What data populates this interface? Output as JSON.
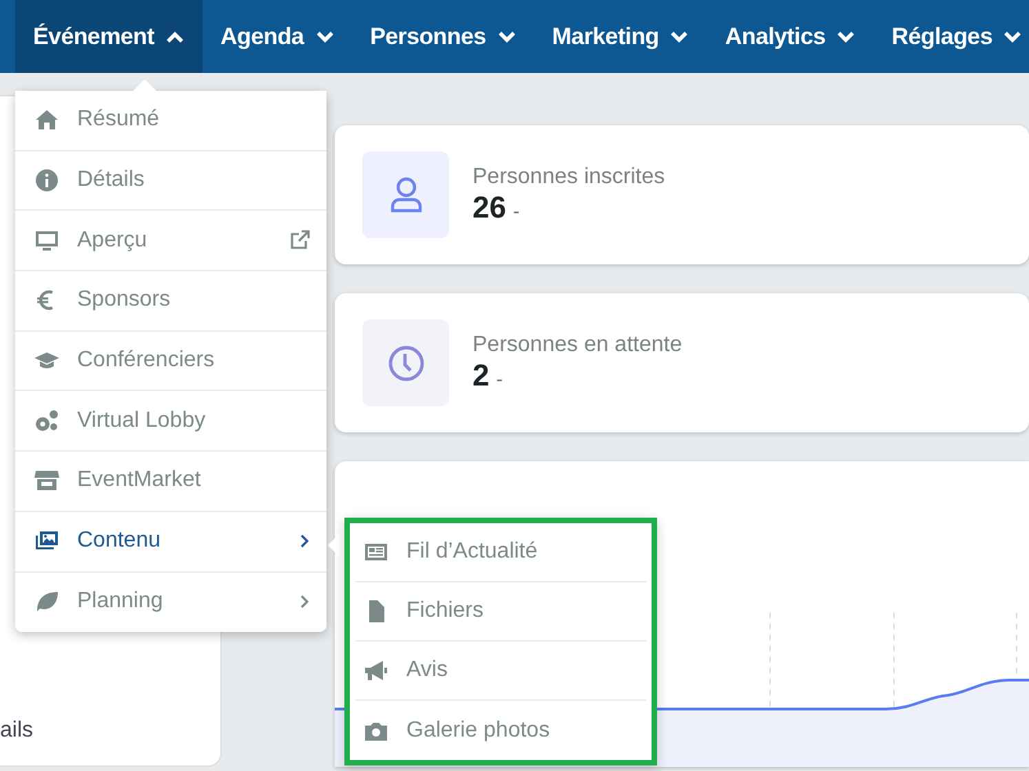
{
  "nav": {
    "items": [
      {
        "label": "Événement",
        "expanded": true,
        "selected": true
      },
      {
        "label": "Agenda",
        "expanded": false,
        "selected": false
      },
      {
        "label": "Personnes",
        "expanded": false,
        "selected": false
      },
      {
        "label": "Marketing",
        "expanded": false,
        "selected": false
      },
      {
        "label": "Analytics",
        "expanded": false,
        "selected": false
      },
      {
        "label": "Réglages",
        "expanded": false,
        "selected": false
      }
    ]
  },
  "side_panel": {
    "text": "ails"
  },
  "stats": [
    {
      "label": "Personnes inscrites",
      "value": "26",
      "suffix": "-"
    },
    {
      "label": "Personnes en attente",
      "value": "2",
      "suffix": "-"
    }
  ],
  "event_menu": {
    "items": [
      {
        "label": "Résumé",
        "selected": false,
        "external": false,
        "submenu": false
      },
      {
        "label": "Détails",
        "selected": false,
        "external": false,
        "submenu": false
      },
      {
        "label": "Aperçu",
        "selected": false,
        "external": true,
        "submenu": false
      },
      {
        "label": "Sponsors",
        "selected": false,
        "external": false,
        "submenu": false
      },
      {
        "label": "Conférenciers",
        "selected": false,
        "external": false,
        "submenu": false
      },
      {
        "label": "Virtual Lobby",
        "selected": false,
        "external": false,
        "submenu": false
      },
      {
        "label": "EventMarket",
        "selected": false,
        "external": false,
        "submenu": false
      },
      {
        "label": "Contenu",
        "selected": true,
        "external": false,
        "submenu": true
      },
      {
        "label": "Planning",
        "selected": false,
        "external": false,
        "submenu": true
      }
    ]
  },
  "content_submenu": {
    "highlighted": true,
    "items": [
      {
        "label": "Fil d’Actualité"
      },
      {
        "label": "Fichiers"
      },
      {
        "label": "Avis"
      },
      {
        "label": "Galerie photos"
      }
    ]
  }
}
